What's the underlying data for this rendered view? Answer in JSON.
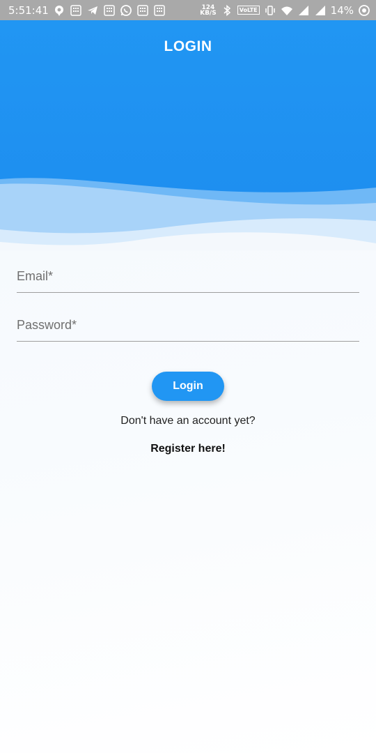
{
  "status_bar": {
    "time": "5:51:41",
    "net_speed_value": "124",
    "net_speed_unit": "KB/S",
    "volte": "VoLTE",
    "battery": "14%"
  },
  "header": {
    "title": "LOGIN"
  },
  "form": {
    "email_placeholder": "Email*",
    "password_placeholder": "Password*",
    "login_label": "Login",
    "no_account_text": "Don't have an account yet?",
    "register_label": "Register here!"
  },
  "colors": {
    "primary": "#2196f3",
    "status_bar": "#a9a9a9"
  }
}
